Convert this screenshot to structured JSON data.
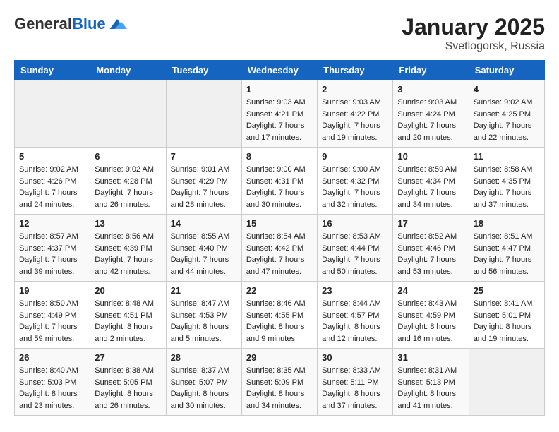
{
  "header": {
    "logo_general": "General",
    "logo_blue": "Blue",
    "title": "January 2025",
    "subtitle": "Svetlogorsk, Russia"
  },
  "days_of_week": [
    "Sunday",
    "Monday",
    "Tuesday",
    "Wednesday",
    "Thursday",
    "Friday",
    "Saturday"
  ],
  "weeks": [
    [
      {
        "day": "",
        "empty": true
      },
      {
        "day": "",
        "empty": true
      },
      {
        "day": "",
        "empty": true
      },
      {
        "day": "1",
        "sunrise": "9:03 AM",
        "sunset": "4:21 PM",
        "daylight": "7 hours and 17 minutes."
      },
      {
        "day": "2",
        "sunrise": "9:03 AM",
        "sunset": "4:22 PM",
        "daylight": "7 hours and 19 minutes."
      },
      {
        "day": "3",
        "sunrise": "9:03 AM",
        "sunset": "4:24 PM",
        "daylight": "7 hours and 20 minutes."
      },
      {
        "day": "4",
        "sunrise": "9:02 AM",
        "sunset": "4:25 PM",
        "daylight": "7 hours and 22 minutes."
      }
    ],
    [
      {
        "day": "5",
        "sunrise": "9:02 AM",
        "sunset": "4:26 PM",
        "daylight": "7 hours and 24 minutes."
      },
      {
        "day": "6",
        "sunrise": "9:02 AM",
        "sunset": "4:28 PM",
        "daylight": "7 hours and 26 minutes."
      },
      {
        "day": "7",
        "sunrise": "9:01 AM",
        "sunset": "4:29 PM",
        "daylight": "7 hours and 28 minutes."
      },
      {
        "day": "8",
        "sunrise": "9:00 AM",
        "sunset": "4:31 PM",
        "daylight": "7 hours and 30 minutes."
      },
      {
        "day": "9",
        "sunrise": "9:00 AM",
        "sunset": "4:32 PM",
        "daylight": "7 hours and 32 minutes."
      },
      {
        "day": "10",
        "sunrise": "8:59 AM",
        "sunset": "4:34 PM",
        "daylight": "7 hours and 34 minutes."
      },
      {
        "day": "11",
        "sunrise": "8:58 AM",
        "sunset": "4:35 PM",
        "daylight": "7 hours and 37 minutes."
      }
    ],
    [
      {
        "day": "12",
        "sunrise": "8:57 AM",
        "sunset": "4:37 PM",
        "daylight": "7 hours and 39 minutes."
      },
      {
        "day": "13",
        "sunrise": "8:56 AM",
        "sunset": "4:39 PM",
        "daylight": "7 hours and 42 minutes."
      },
      {
        "day": "14",
        "sunrise": "8:55 AM",
        "sunset": "4:40 PM",
        "daylight": "7 hours and 44 minutes."
      },
      {
        "day": "15",
        "sunrise": "8:54 AM",
        "sunset": "4:42 PM",
        "daylight": "7 hours and 47 minutes."
      },
      {
        "day": "16",
        "sunrise": "8:53 AM",
        "sunset": "4:44 PM",
        "daylight": "7 hours and 50 minutes."
      },
      {
        "day": "17",
        "sunrise": "8:52 AM",
        "sunset": "4:46 PM",
        "daylight": "7 hours and 53 minutes."
      },
      {
        "day": "18",
        "sunrise": "8:51 AM",
        "sunset": "4:47 PM",
        "daylight": "7 hours and 56 minutes."
      }
    ],
    [
      {
        "day": "19",
        "sunrise": "8:50 AM",
        "sunset": "4:49 PM",
        "daylight": "7 hours and 59 minutes."
      },
      {
        "day": "20",
        "sunrise": "8:48 AM",
        "sunset": "4:51 PM",
        "daylight": "8 hours and 2 minutes."
      },
      {
        "day": "21",
        "sunrise": "8:47 AM",
        "sunset": "4:53 PM",
        "daylight": "8 hours and 5 minutes."
      },
      {
        "day": "22",
        "sunrise": "8:46 AM",
        "sunset": "4:55 PM",
        "daylight": "8 hours and 9 minutes."
      },
      {
        "day": "23",
        "sunrise": "8:44 AM",
        "sunset": "4:57 PM",
        "daylight": "8 hours and 12 minutes."
      },
      {
        "day": "24",
        "sunrise": "8:43 AM",
        "sunset": "4:59 PM",
        "daylight": "8 hours and 16 minutes."
      },
      {
        "day": "25",
        "sunrise": "8:41 AM",
        "sunset": "5:01 PM",
        "daylight": "8 hours and 19 minutes."
      }
    ],
    [
      {
        "day": "26",
        "sunrise": "8:40 AM",
        "sunset": "5:03 PM",
        "daylight": "8 hours and 23 minutes."
      },
      {
        "day": "27",
        "sunrise": "8:38 AM",
        "sunset": "5:05 PM",
        "daylight": "8 hours and 26 minutes."
      },
      {
        "day": "28",
        "sunrise": "8:37 AM",
        "sunset": "5:07 PM",
        "daylight": "8 hours and 30 minutes."
      },
      {
        "day": "29",
        "sunrise": "8:35 AM",
        "sunset": "5:09 PM",
        "daylight": "8 hours and 34 minutes."
      },
      {
        "day": "30",
        "sunrise": "8:33 AM",
        "sunset": "5:11 PM",
        "daylight": "8 hours and 37 minutes."
      },
      {
        "day": "31",
        "sunrise": "8:31 AM",
        "sunset": "5:13 PM",
        "daylight": "8 hours and 41 minutes."
      },
      {
        "day": "",
        "empty": true
      }
    ]
  ]
}
